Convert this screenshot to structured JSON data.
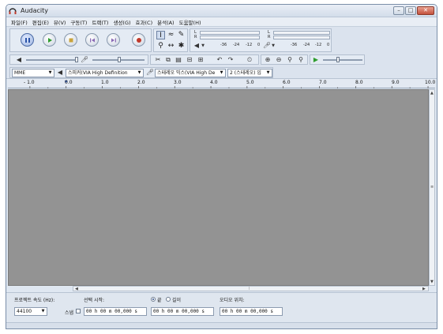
{
  "window": {
    "title": "Audacity",
    "controls": [
      "minimize",
      "maximize",
      "close"
    ]
  },
  "menu": [
    "파일(F)",
    "편집(E)",
    "뷰(V)",
    "구동(T)",
    "트랙(T)",
    "생성(G)",
    "효과(C)",
    "분석(A)",
    "도움말(H)"
  ],
  "meter": {
    "record_scale": [
      "-36",
      "-24",
      "-12",
      "0"
    ],
    "play_scale": [
      "-36",
      "-24",
      "-12",
      "0"
    ],
    "channel_left": "L",
    "channel_right": "R"
  },
  "device": {
    "host": "MME",
    "output": "스피커(VIA High Definition",
    "input": "스테레오 믹스(VIA High De",
    "channels": "2 (스테레오) 입"
  },
  "ruler": {
    "ticks": [
      "- 1.0",
      "0.0",
      "1.0",
      "2.0",
      "3.0",
      "4.0",
      "5.0",
      "6.0",
      "7.0",
      "8.0",
      "9.0",
      "10.0"
    ]
  },
  "selection": {
    "rate_label": "프로젝트 속도 (Hz):",
    "rate_value": "44100",
    "snap_label": "스냅",
    "start_label": "선택 시작:",
    "end_option": "끝",
    "length_option": "길이",
    "audio_pos_label": "오디오 위치:",
    "start_time": "00 h 00 m 00,000 s",
    "end_time": "00 h 00 m 00,000 s",
    "audio_time": "00 h 00 m 00,000 s"
  },
  "colors": {
    "track_bg": "#939393",
    "chrome": "#dfe7f1",
    "accent_play": "#2e9c2e",
    "accent_record": "#c0392b",
    "accent_pause": "#2b54a8"
  }
}
